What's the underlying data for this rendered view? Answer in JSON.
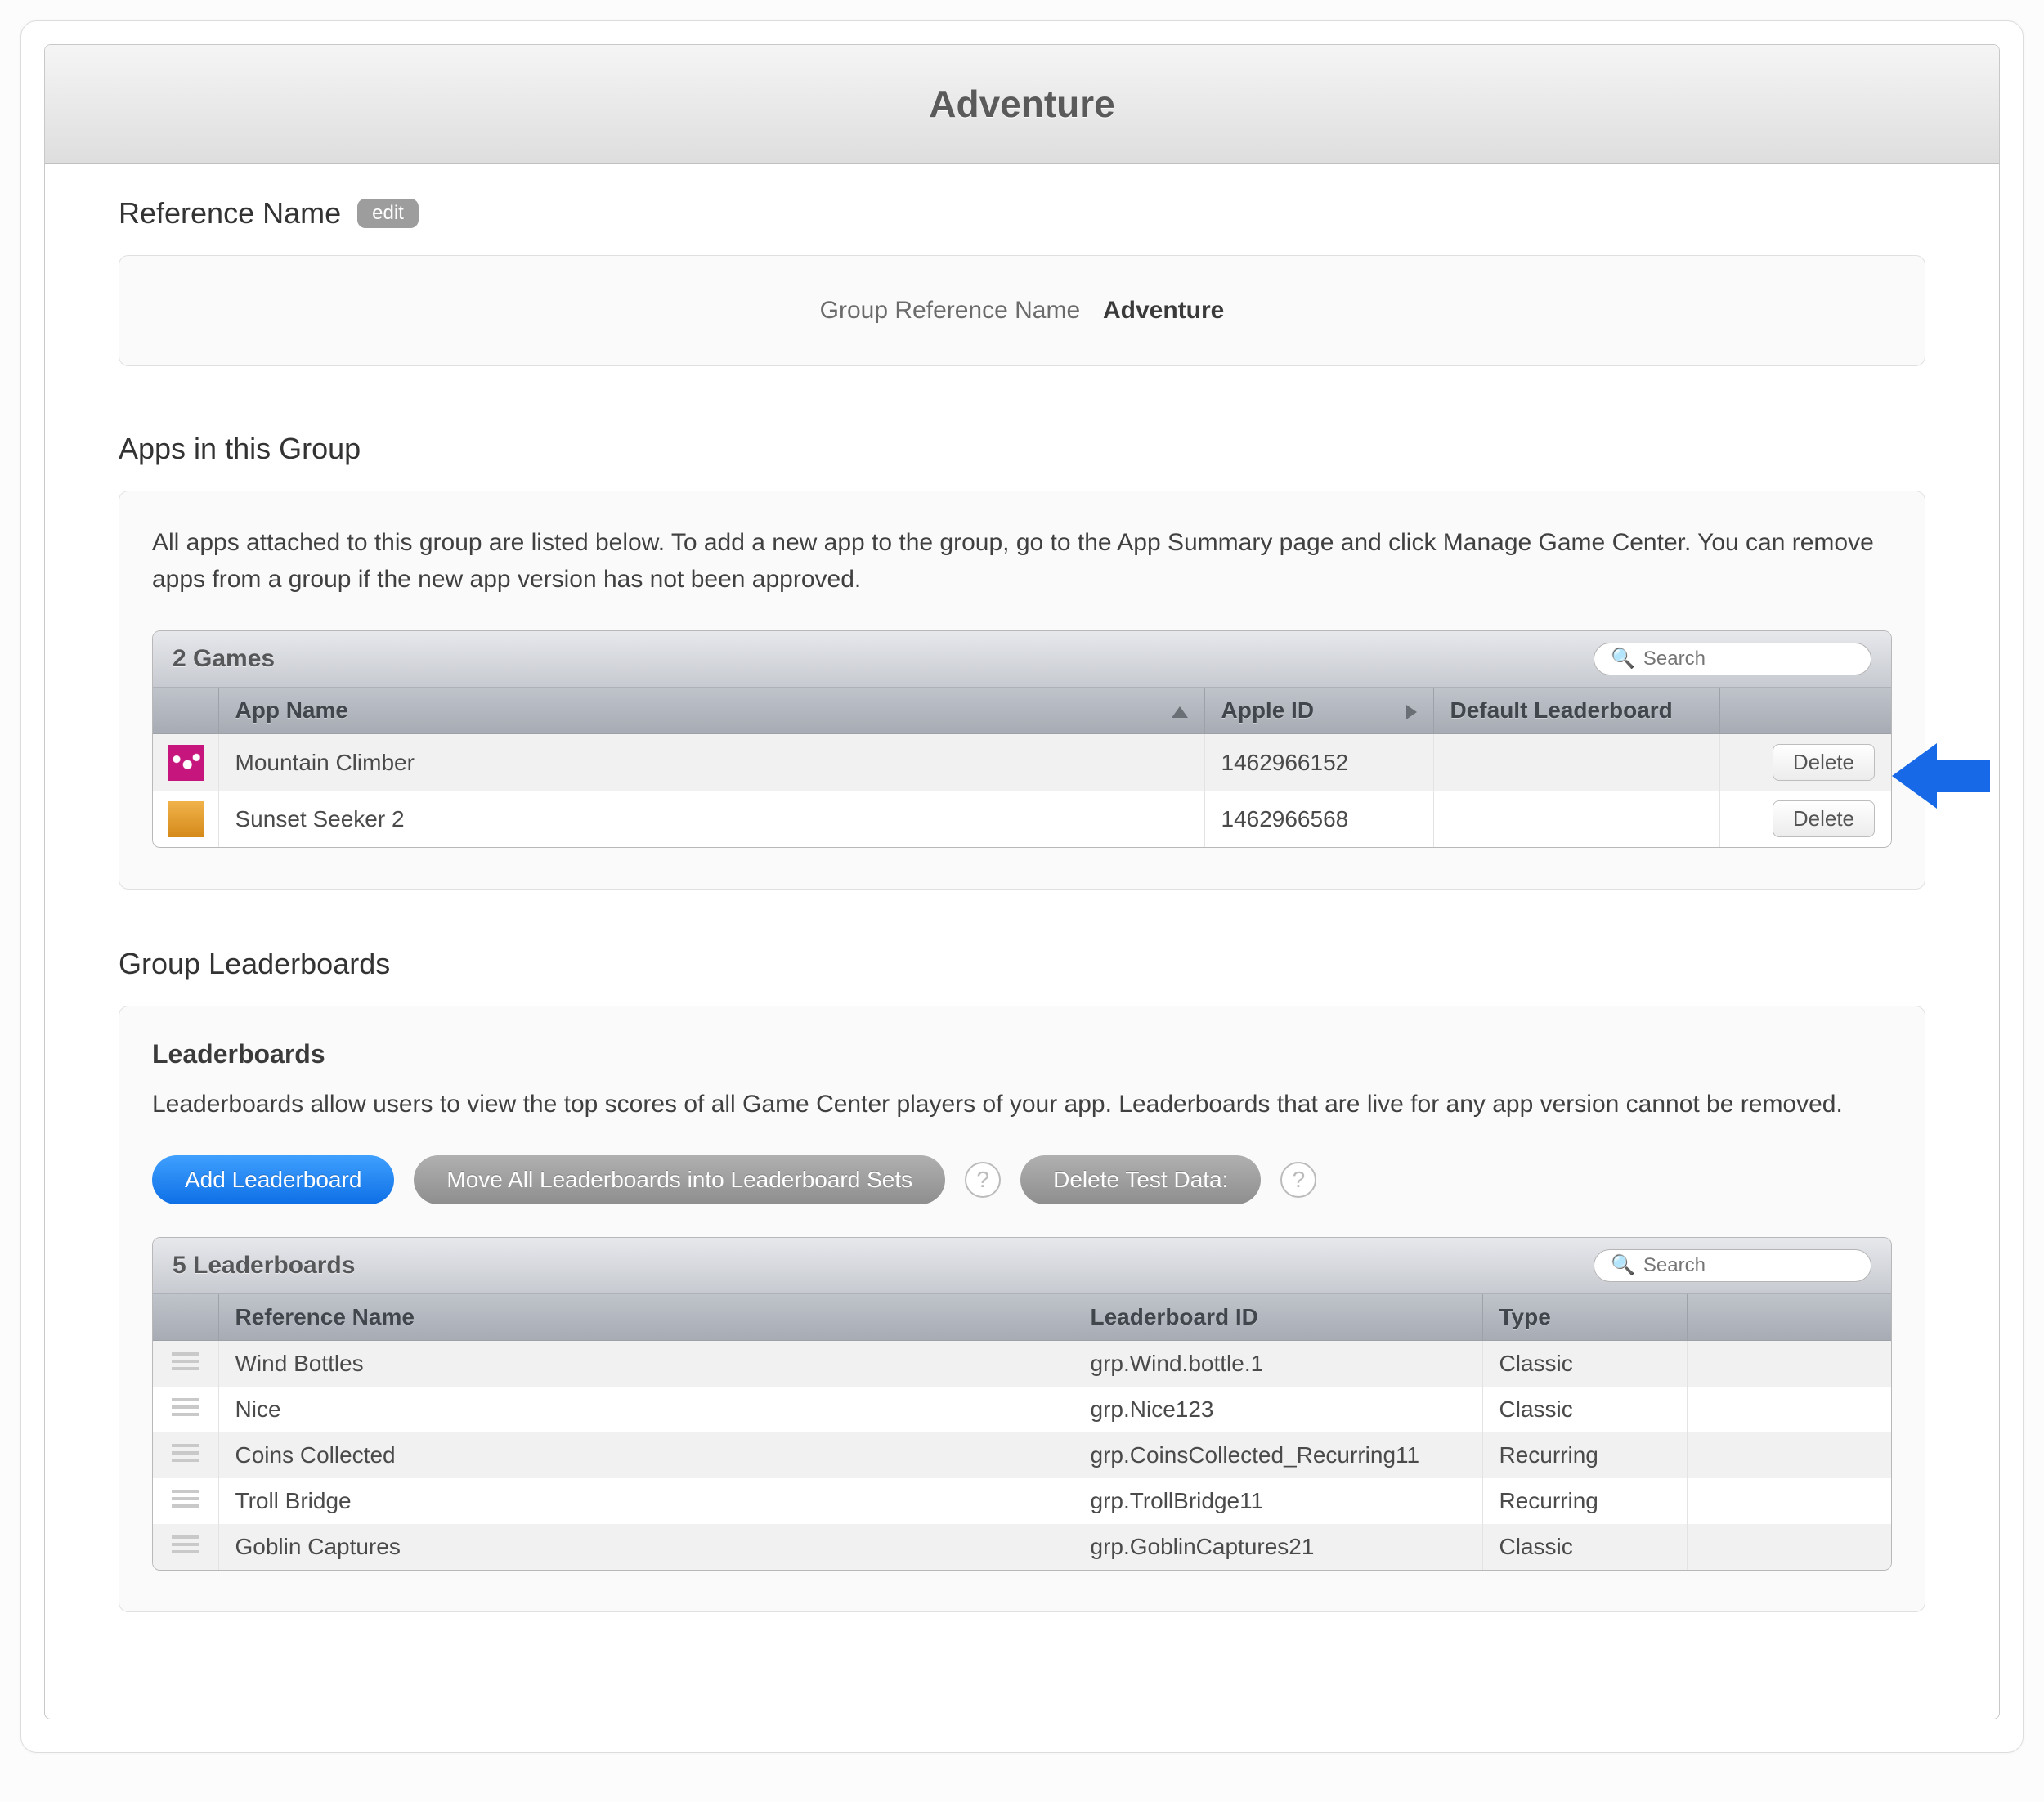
{
  "page_title": "Adventure",
  "reference_name": {
    "heading": "Reference Name",
    "edit_label": "edit",
    "label": "Group Reference Name",
    "value": "Adventure"
  },
  "apps_section": {
    "heading": "Apps in this Group",
    "description": "All apps attached to this group are listed below. To add a new app to the group, go to the App Summary page and click Manage Game Center. You can remove apps from a group if the new app version has not been approved.",
    "table_title": "2 Games",
    "search_placeholder": "Search",
    "columns": {
      "app_name": "App Name",
      "apple_id": "Apple ID",
      "default_leaderboard": "Default Leaderboard"
    },
    "rows": [
      {
        "icon": "magenta",
        "name": "Mountain Climber",
        "apple_id": "1462966152",
        "default_leaderboard": "",
        "delete": "Delete"
      },
      {
        "icon": "orange",
        "name": "Sunset Seeker 2",
        "apple_id": "1462966568",
        "default_leaderboard": "",
        "delete": "Delete"
      }
    ]
  },
  "leaderboards_section": {
    "heading": "Group Leaderboards",
    "subtitle": "Leaderboards",
    "description": "Leaderboards allow users to view the top scores of all Game Center players of your app. Leaderboards that are live for any app version cannot be removed.",
    "buttons": {
      "add": "Add Leaderboard",
      "move": "Move All Leaderboards into Leaderboard Sets",
      "delete_test": "Delete Test Data:"
    },
    "table_title": "5 Leaderboards",
    "search_placeholder": "Search",
    "columns": {
      "ref_name": "Reference Name",
      "lb_id": "Leaderboard ID",
      "type": "Type"
    },
    "rows": [
      {
        "name": "Wind Bottles",
        "id": "grp.Wind.bottle.1",
        "type": "Classic"
      },
      {
        "name": "Nice",
        "id": "grp.Nice123",
        "type": "Classic"
      },
      {
        "name": "Coins Collected",
        "id": "grp.CoinsCollected_Recurring11",
        "type": "Recurring"
      },
      {
        "name": "Troll Bridge",
        "id": "grp.TrollBridge11",
        "type": "Recurring"
      },
      {
        "name": "Goblin Captures",
        "id": "grp.GoblinCaptures21",
        "type": "Classic"
      }
    ]
  }
}
